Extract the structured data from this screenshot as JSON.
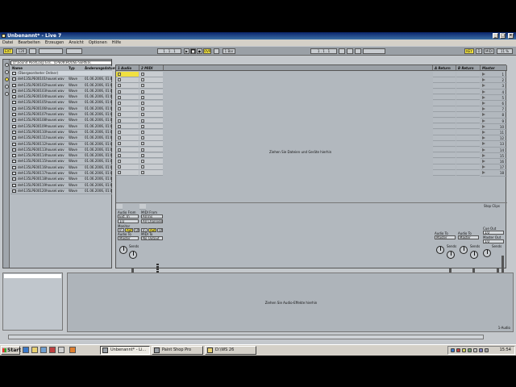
{
  "window": {
    "title": "Unbenannt* - Live 7"
  },
  "menu": [
    "Datei",
    "Bearbeiten",
    "Erzeugen",
    "Ansicht",
    "Optionen",
    "Hilfe"
  ],
  "transport": {
    "ext_label": "EXT",
    "tempo": "120",
    "quantize": "1 Bar",
    "ovr_label": "OVR",
    "position": "1 . 1 . 1",
    "pos2": "1 . 1 . 1",
    "key_label": "KEY",
    "midi_label": "MIDI",
    "page_label": "D",
    "cpu": "11 %"
  },
  "browser": {
    "path": "D:\\Sound Pool\\Loop Ess...\\LPE06\\HOUSE-SERIES\\",
    "columns": [
      "Name",
      "Typ",
      "Änderungsdatum"
    ],
    "parent_label": "(Übergeordneter Ordner)",
    "files": [
      {
        "name": "deh135LPE00101housel.wav",
        "type": "Wave",
        "date": "01.06.2006, 01:0"
      },
      {
        "name": "deh135LPE00102housel.wav",
        "type": "Wave",
        "date": "01.06.2006, 01:0"
      },
      {
        "name": "deh135LPE00103housel.wav",
        "type": "Wave",
        "date": "01.06.2006, 01:0"
      },
      {
        "name": "deh135LPE00104housel.wav",
        "type": "Wave",
        "date": "01.06.2006, 01:0"
      },
      {
        "name": "deh135LPE00105housel.wav",
        "type": "Wave",
        "date": "01.06.2006, 01:0"
      },
      {
        "name": "deh135LPE00106housel.wav",
        "type": "Wave",
        "date": "01.06.2006, 01:0"
      },
      {
        "name": "deh135LPE00107housel.wav",
        "type": "Wave",
        "date": "01.06.2006, 01:0"
      },
      {
        "name": "deh135LPE00108housel.wav",
        "type": "Wave",
        "date": "01.06.2006, 01:0"
      },
      {
        "name": "deh135LPE00109housel.wav",
        "type": "Wave",
        "date": "01.06.2006, 01:0"
      },
      {
        "name": "deh135LPE00110housel.wav",
        "type": "Wave",
        "date": "01.06.2006, 01:0"
      },
      {
        "name": "deh135LPE00111housel.wav",
        "type": "Wave",
        "date": "01.06.2006, 01:0"
      },
      {
        "name": "deh135LPE00112housel.wav",
        "type": "Wave",
        "date": "01.06.2006, 01:0"
      },
      {
        "name": "deh135LPE00113housel.wav",
        "type": "Wave",
        "date": "01.06.2006, 01:0"
      },
      {
        "name": "deh135LPE00114housel.wav",
        "type": "Wave",
        "date": "01.06.2006, 01:0"
      },
      {
        "name": "deh135LPE00115housel.wav",
        "type": "Wave",
        "date": "01.06.2006, 01:0"
      },
      {
        "name": "deh135LPE00116housel.wav",
        "type": "Wave",
        "date": "01.06.2006, 01:0"
      },
      {
        "name": "deh135LPE00117housel.wav",
        "type": "Wave",
        "date": "01.06.2006, 01:0"
      },
      {
        "name": "deh135LPE00118housel.wav",
        "type": "Wave",
        "date": "01.06.2006, 01:0"
      },
      {
        "name": "deh135LPE00119housel.wav",
        "type": "Wave",
        "date": "01.06.2006, 01:0"
      },
      {
        "name": "deh135LPE00120housel.wav",
        "type": "Wave",
        "date": "01.06.2006, 01:0"
      }
    ]
  },
  "session": {
    "tracks": [
      {
        "name": "1 Audio",
        "number": "1"
      },
      {
        "name": "2 MIDI",
        "number": "2"
      },
      {
        "name": "A Return",
        "number": "A"
      },
      {
        "name": "B Return",
        "number": "B"
      }
    ],
    "master_label": "Master",
    "drop_hint": "Ziehen Sie Dateien und Geräte hierhin",
    "scenes": [
      "1",
      "2",
      "3",
      "4",
      "5",
      "6",
      "7",
      "8",
      "9",
      "10",
      "11",
      "12",
      "13",
      "14",
      "15",
      "16",
      "17",
      "18"
    ],
    "stop_clips": "Stop Clips",
    "mixer": {
      "audio_from": "Audio From",
      "midi_from": "MIDI From",
      "ext_in": "Ext. In",
      "all_ins": "All Ins",
      "in_1": "1/2",
      "all_channels": "All Channels",
      "monitor": "Monitor",
      "mon_in": "In",
      "mon_auto": "Auto",
      "mon_off": "Off",
      "audio_to": "Audio To",
      "midi_to": "MIDI To",
      "to_master": "Master",
      "no_output": "No Output",
      "sends": "Sends",
      "cue_out": "Cue Out",
      "cue_val": "1/2",
      "master_out": "Master Out",
      "master_val": "1/2",
      "solo": "S",
      "arm": "0"
    }
  },
  "detail": {
    "drop_hint": "Ziehen Sie Audio-Effekte hierhin",
    "right_label": "1-Audio"
  },
  "taskbar": {
    "start": "Start",
    "tasks": [
      "Unbenannt* - Li...",
      "Paint Shop Pro",
      "D:\\WS 26"
    ],
    "clock": "15:54"
  }
}
